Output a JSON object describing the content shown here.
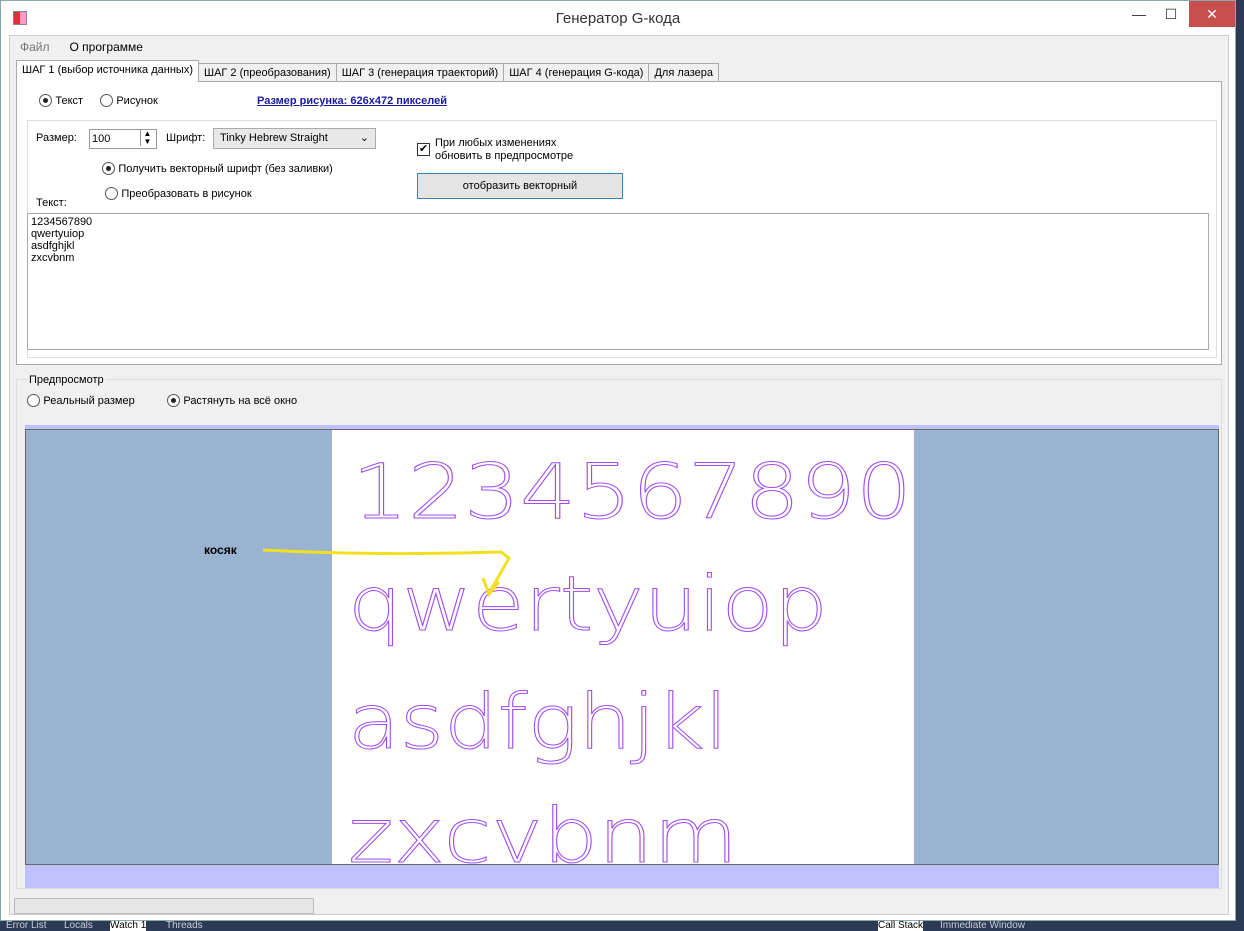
{
  "window": {
    "title": "Генератор G-кода",
    "minimize": "—",
    "maximize": "☐",
    "close": "✕"
  },
  "menu": [
    "Файл",
    "О программе"
  ],
  "tabs": [
    "ШАГ 1 (выбор источника данных)",
    "ШАГ 2 (преобразования)",
    "ШАГ 3 (генерация траекторий)",
    "ШАГ 4 (генерация G-кода)",
    "Для лазера"
  ],
  "step1": {
    "source_text": "Текст",
    "source_image": "Рисунок",
    "source_selected": "Текст",
    "image_size_link": "Размер рисунка: 626x472 пикселей",
    "size_label": "Размер:",
    "size_value": "100",
    "font_label": "Шрифт:",
    "font_value": "Tinky Hebrew Straight",
    "vector_option": "Получить векторный шрифт (без заливки)",
    "raster_option": "Преобразовать в рисунок",
    "mode_selected": "vector",
    "auto_update_label": "При любых изменениях обновить в предпросмотре",
    "auto_update_checked": true,
    "show_vector_button": "отобразить векторный",
    "text_label": "Текст:",
    "text_value": "1234567890\nqwertyuiop\nasdfghjkl\nzxcvbnm"
  },
  "preview": {
    "group_label": "Предпросмотр",
    "real_size": "Реальный размер",
    "stretch": "Растянуть на всё окно",
    "selected": "stretch",
    "lines": [
      "1234567890",
      "qwertyuiop",
      "asdfghjkl",
      "zxcvbnm"
    ],
    "stroke_color": "#a04cf0",
    "annotation": "косяк",
    "annotation_color": "#f0e020"
  },
  "background_tabs": [
    "Error List",
    "Locals",
    "Watch 1",
    "Threads",
    "Call Stack",
    "Immediate Window"
  ]
}
